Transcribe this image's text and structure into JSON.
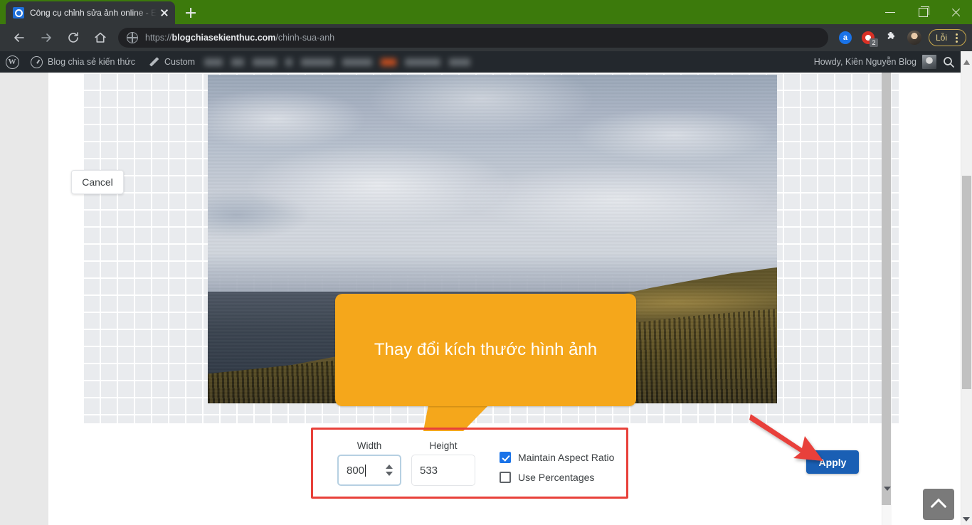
{
  "browser": {
    "tab": {
      "title": "Công cụ chỉnh sửa ảnh online - E",
      "favicon": "camera-icon",
      "close": "close-icon"
    },
    "newtab_label": "+",
    "window_controls": {
      "minimize": "minimize-icon",
      "maximize": "maximize-icon",
      "close": "close-icon"
    },
    "nav": {
      "back": "back-arrow-icon",
      "forward": "forward-arrow-icon",
      "reload": "reload-icon",
      "home": "home-icon"
    },
    "omnibox": {
      "scheme": "https://",
      "domain": "blogchiasekienthuc.com",
      "path": "/chinh-sua-anh",
      "full_url": "https://blogchiasekienthuc.com/chinh-sua-anh",
      "site_icon": "globe-icon"
    },
    "toolbar_icons": [
      {
        "name": "adblock-icon",
        "label": "a"
      },
      {
        "name": "screen-recorder-icon",
        "badge": "2"
      },
      {
        "name": "extensions-puzzle-icon"
      },
      {
        "name": "profile-avatar-icon"
      }
    ],
    "error_pill": {
      "label": "Lỗi",
      "menu": "kebab-menu-icon"
    },
    "theme_color": "#3c7a0c"
  },
  "wp_admin_bar": {
    "logo": "wordpress-logo-icon",
    "site_name": "Blog chia sẻ kiến thức",
    "customize": "Custom",
    "blurred_items_count": 7,
    "howdy": "Howdy, Kiên Nguyễn Blog",
    "avatar": "user-avatar",
    "search": "search-icon"
  },
  "editor": {
    "canvas": {
      "background": "transparency-checkerboard",
      "image_alt": "sea-of-clouds-over-mountain-ridge"
    },
    "callout": {
      "text": "Thay đổi kích thước hình ảnh",
      "color": "#f5a71b",
      "text_color": "#ffffff"
    },
    "cancel_label": "Cancel",
    "apply_label": "Apply",
    "apply_color": "#1a5fb4",
    "highlight_box_color": "#e8413a",
    "arrow_color": "#e8413a",
    "form": {
      "width": {
        "label": "Width",
        "value": "800",
        "focused": true,
        "spinner": "stepper-icon"
      },
      "height": {
        "label": "Height",
        "value": "533",
        "focused": false
      },
      "maintain_aspect_ratio": {
        "label": "Maintain Aspect Ratio",
        "checked": true
      },
      "use_percentages": {
        "label": "Use Percentages",
        "checked": false
      }
    }
  },
  "page_controls": {
    "scroll_to_top": "chevron-up-icon",
    "inner_scrollbar": "modal-scrollbar",
    "outer_scrollbar": "page-scrollbar"
  }
}
